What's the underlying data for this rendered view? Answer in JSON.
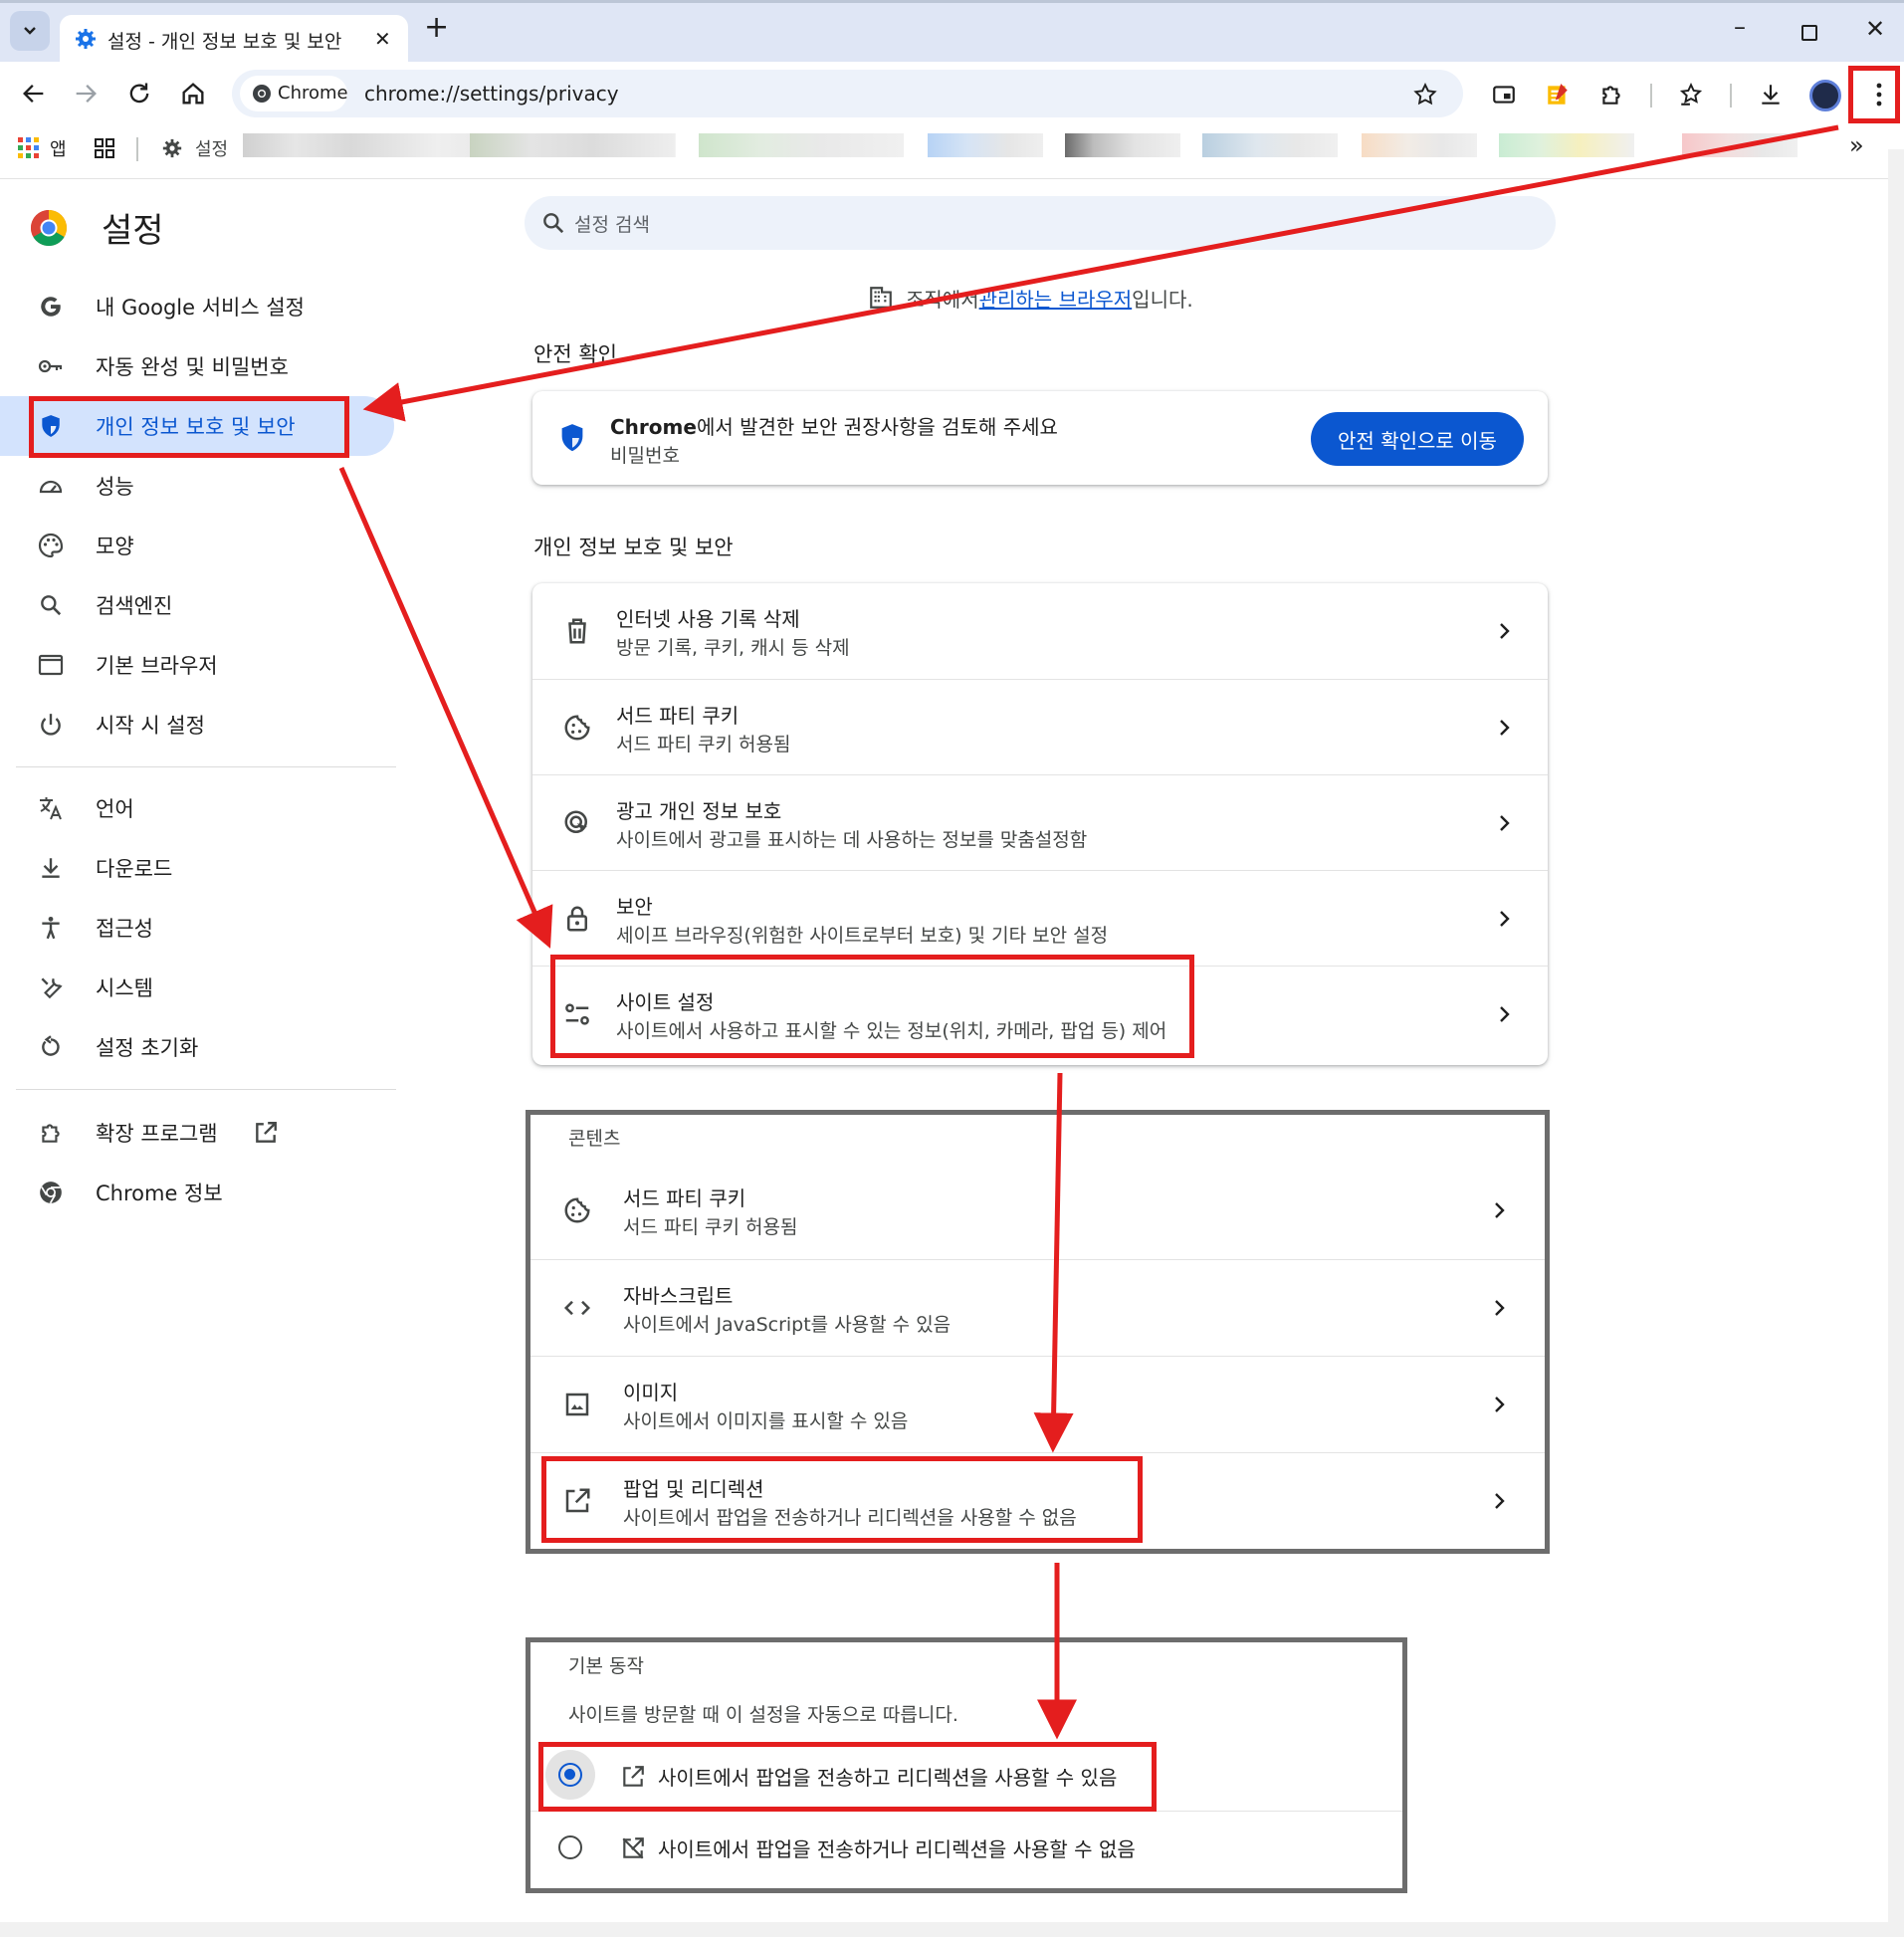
{
  "window": {
    "tab_title": "설정 - 개인 정보 보호 및 보안",
    "new_tab_symbol": "+",
    "minimize_symbol": "–",
    "close_symbol": "✕"
  },
  "toolbar": {
    "site_chip": "Chrome",
    "url": "chrome://settings/privacy"
  },
  "bookmarks": {
    "apps_label": "앱",
    "settings_label": "설정",
    "more_symbol": "»"
  },
  "sidebar": {
    "title": "설정",
    "items": [
      {
        "label": "내 Google 서비스 설정",
        "icon": "google-g-icon"
      },
      {
        "label": "자동 완성 및 비밀번호",
        "icon": "key-icon"
      },
      {
        "label": "개인 정보 보호 및 보안",
        "icon": "shield-icon",
        "active": true
      },
      {
        "label": "성능",
        "icon": "speedometer-icon"
      },
      {
        "label": "모양",
        "icon": "palette-icon"
      },
      {
        "label": "검색엔진",
        "icon": "search-icon"
      },
      {
        "label": "기본 브라우저",
        "icon": "browser-window-icon"
      },
      {
        "label": "시작 시 설정",
        "icon": "power-icon"
      },
      {
        "label": "언어",
        "icon": "translate-icon"
      },
      {
        "label": "다운로드",
        "icon": "download-icon"
      },
      {
        "label": "접근성",
        "icon": "accessibility-icon"
      },
      {
        "label": "시스템",
        "icon": "wrench-icon"
      },
      {
        "label": "설정 초기화",
        "icon": "reset-icon"
      },
      {
        "label": "확장 프로그램",
        "icon": "puzzle-icon"
      },
      {
        "label": "Chrome 정보",
        "icon": "chrome-icon"
      }
    ]
  },
  "search": {
    "placeholder": "설정 검색"
  },
  "managed_notice": {
    "prefix": "조직에서 ",
    "link": "관리하는 브라우저",
    "suffix": "입니다."
  },
  "safety_check": {
    "heading": "안전 확인",
    "title_bold": "Chrome",
    "title_rest": "에서 발견한 보안 권장사항을 검토해 주세요",
    "subtitle": "비밀번호",
    "button": "안전 확인으로 이동"
  },
  "privacy": {
    "heading": "개인 정보 보호 및 보안",
    "rows": [
      {
        "title": "인터넷 사용 기록 삭제",
        "subtitle": "방문 기록, 쿠키, 캐시 등 삭제",
        "icon": "trash-icon"
      },
      {
        "title": "서드 파티 쿠키",
        "subtitle": "서드 파티 쿠키 허용됨",
        "icon": "cookie-icon"
      },
      {
        "title": "광고 개인 정보 보호",
        "subtitle": "사이트에서 광고를 표시하는 데 사용하는 정보를 맞춤설정함",
        "icon": "ad-privacy-icon"
      },
      {
        "title": "보안",
        "subtitle": "세이프 브라우징(위험한 사이트로부터 보호) 및 기타 보안 설정",
        "icon": "lock-icon"
      },
      {
        "title": "사이트 설정",
        "subtitle": "사이트에서 사용하고 표시할 수 있는 정보(위치, 카메라, 팝업 등) 제어",
        "icon": "tune-icon"
      }
    ]
  },
  "content": {
    "heading": "콘텐츠",
    "rows": [
      {
        "title": "서드 파티 쿠키",
        "subtitle": "서드 파티 쿠키 허용됨",
        "icon": "cookie-icon"
      },
      {
        "title": "자바스크립트",
        "subtitle": "사이트에서 JavaScript를 사용할 수 있음",
        "icon": "code-icon"
      },
      {
        "title": "이미지",
        "subtitle": "사이트에서 이미지를 표시할 수 있음",
        "icon": "image-icon"
      },
      {
        "title": "팝업 및 리디렉션",
        "subtitle": "사이트에서 팝업을 전송하거나 리디렉션을 사용할 수 없음",
        "icon": "open-in-new-icon"
      }
    ]
  },
  "default_behavior": {
    "heading": "기본 동작",
    "description": "사이트를 방문할 때 이 설정을 자동으로 따릅니다.",
    "options": [
      {
        "label": "사이트에서 팝업을 전송하고 리디렉션을 사용할 수 있음",
        "selected": true
      },
      {
        "label": "사이트에서 팝업을 전송하거나 리디렉션을 사용할 수 없음",
        "selected": false
      }
    ]
  },
  "colors": {
    "accent": "#0b57d0",
    "annotation_red": "#e41e1e",
    "annotation_gray": "#6d6d6d",
    "active_nav_bg": "#d3e3fd"
  }
}
